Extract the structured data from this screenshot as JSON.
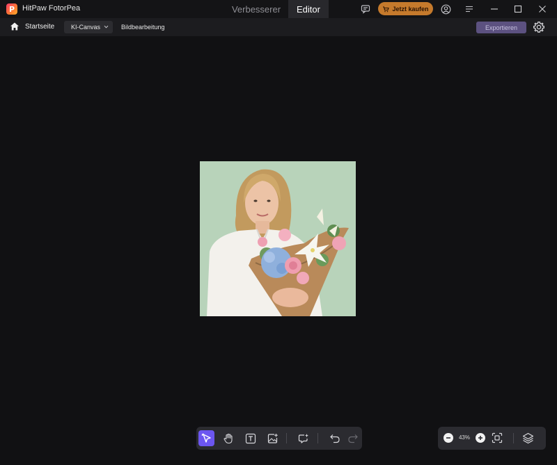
{
  "app": {
    "title": "HitPaw FotorPea",
    "logo_letter": "P"
  },
  "mode_tabs": [
    {
      "label": "Verbesserer",
      "active": false
    },
    {
      "label": "Editor",
      "active": true
    }
  ],
  "titlebar": {
    "buy_label": "Jetzt kaufen",
    "icons": [
      "chat-icon",
      "cart-icon",
      "account-icon",
      "menu-icon",
      "minimize-icon",
      "maximize-icon",
      "close-icon"
    ]
  },
  "toolbar": {
    "home_label": "Startseite",
    "canvas_dropdown": "KI-Canvas",
    "edit_label": "Bildbearbeitung",
    "export_label": "Exportieren"
  },
  "canvas": {
    "image_description_icon": "portrait-photo"
  },
  "tools": {
    "items": [
      "select-tool-icon",
      "hand-tool-icon",
      "text-tool-icon",
      "add-image-icon",
      "ai-assist-icon",
      "undo-icon",
      "redo-icon"
    ],
    "active": "select-tool-icon"
  },
  "zoom": {
    "level": "43%"
  },
  "colors": {
    "accent": "#6c56f0",
    "buy_button": "#c57a2c",
    "export_button": "#5c5180",
    "background": "#111113"
  }
}
